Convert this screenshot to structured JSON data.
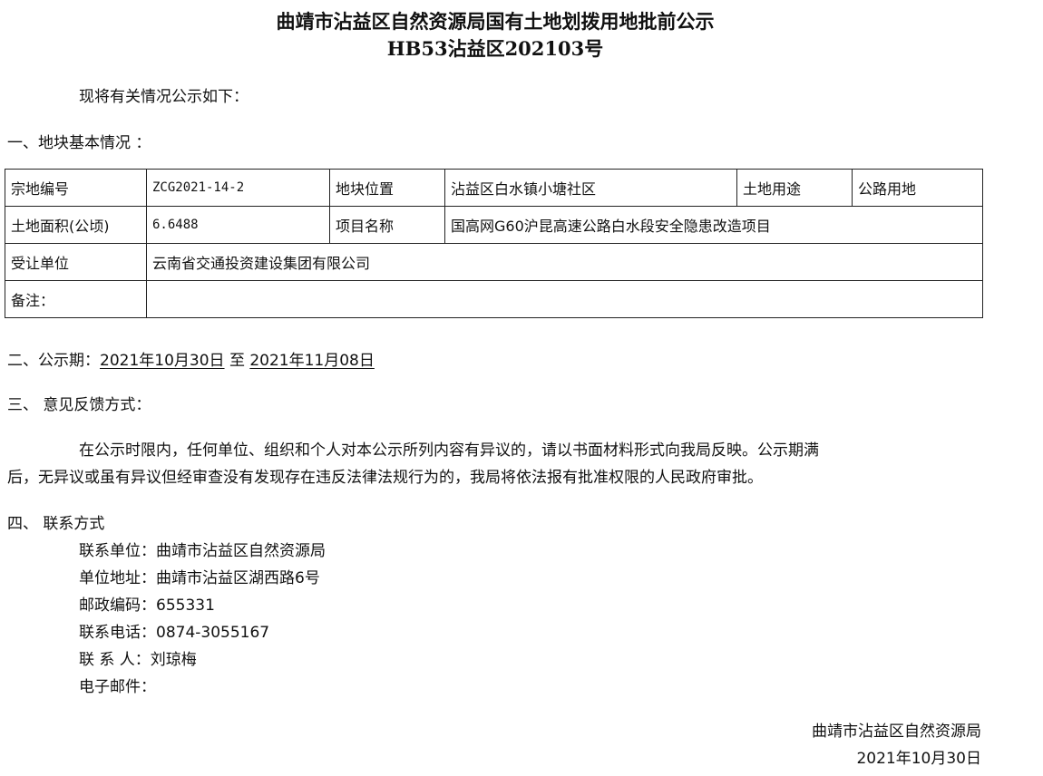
{
  "header": {
    "title": "曲靖市沾益区自然资源局国有土地划拨用地批前公示",
    "doc_number": "HB53沾益区202103号"
  },
  "intro": "现将有关情况公示如下：",
  "section1": {
    "heading": "一、地块基本情况 ："
  },
  "table": {
    "parcel_no_label": "宗地编号",
    "parcel_no": "ZCG2021-14-2",
    "location_label": "地块位置",
    "location": "沾益区白水镇小塘社区",
    "usage_label": "土地用途",
    "usage": "公路用地",
    "area_label": "土地面积(公顷)",
    "area": "6.6488",
    "project_label": "项目名称",
    "project": "国高网G60沪昆高速公路白水段安全隐患改造项目",
    "assignee_label": "受让单位",
    "assignee": "云南省交通投资建设集团有限公司",
    "remark_label": "备注：",
    "remark": ""
  },
  "section2": {
    "heading": "二、公示期：",
    "start": "2021年10月30日",
    "to": "至",
    "end": "2021年11月08日"
  },
  "section3": {
    "heading": "三、  意见反馈方式：",
    "para_line1": "在公示时限内，任何单位、组织和个人对本公示所列内容有异议的，请以书面材料形式向我局反映。公示期满",
    "para_line2": "后，无异议或虽有异议但经审查没有发现存在违反法律法规行为的，我局将依法报有批准权限的人民政府审批。"
  },
  "section4": {
    "heading": "四、  联系方式",
    "unit": "联系单位：曲靖市沾益区自然资源局",
    "address": "单位地址：曲靖市沾益区湖西路6号",
    "postcode": "邮政编码：655331",
    "phone": "联系电话：0874-3055167",
    "contact": "联 系 人：刘琼梅",
    "email": "电子邮件："
  },
  "footer": {
    "issuer": "曲靖市沾益区自然资源局",
    "date": "2021年10月30日"
  }
}
